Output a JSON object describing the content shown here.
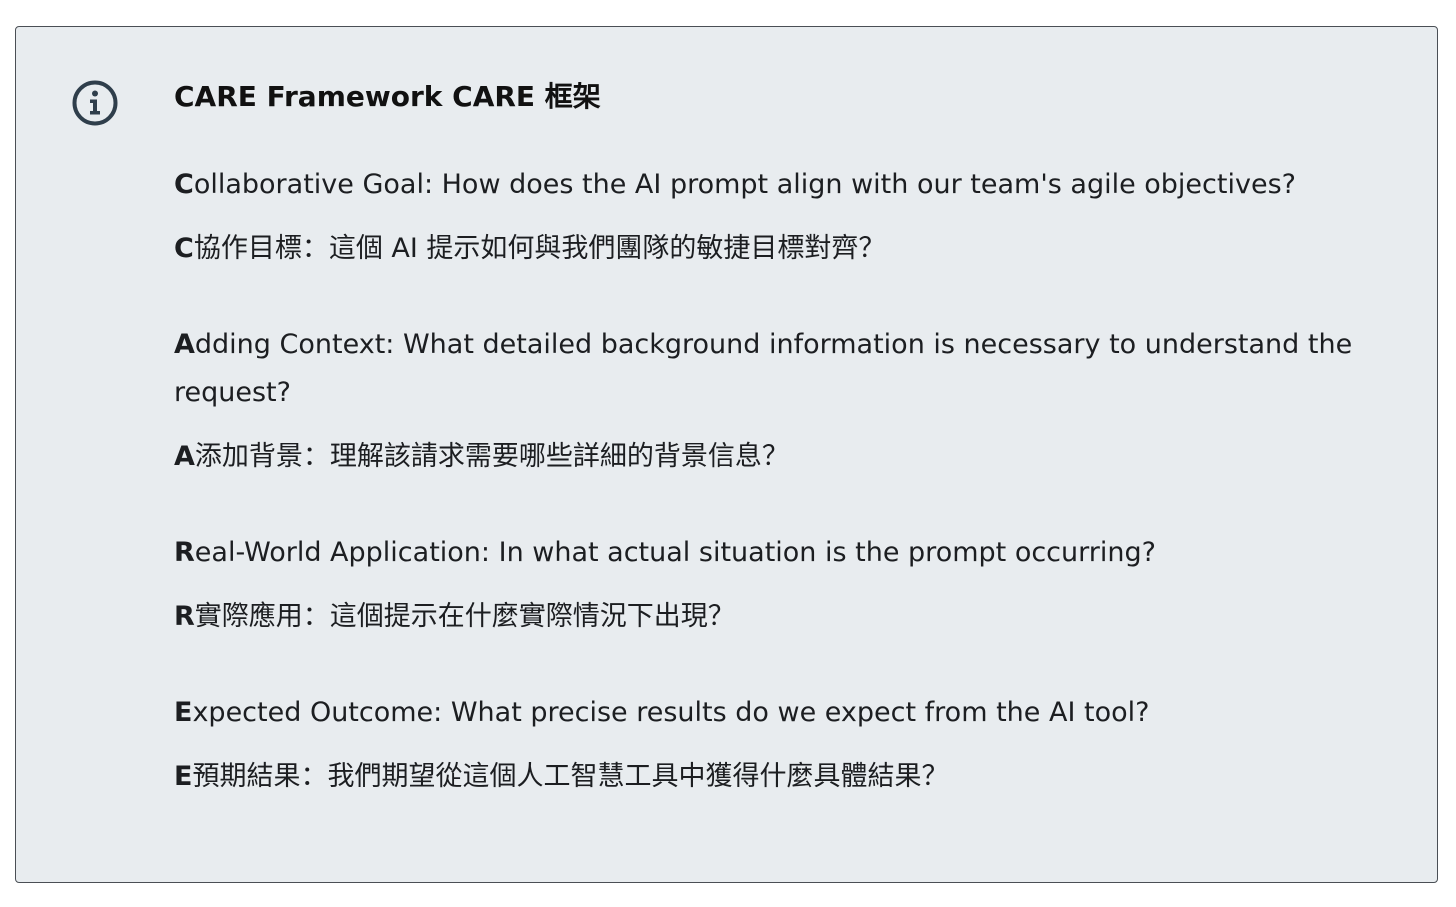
{
  "title": "CARE Framework CARE 框架",
  "icon": "info-icon",
  "colors": {
    "background": "#e8ecef",
    "border": "#4a4f55",
    "icon": "#2f3e4b"
  },
  "sections": [
    {
      "letter": "C",
      "en": "ollaborative Goal: How does the AI prompt align with our team's agile objectives?",
      "zh_letter": "C",
      "zh": "協作目標：這個 AI 提示如何與我們團隊的敏捷目標對齊？"
    },
    {
      "letter": "A",
      "en": "dding Context: What detailed background information is necessary to understand the request?",
      "zh_letter": "A",
      "zh": "添加背景：理解該請求需要哪些詳細的背景信息？"
    },
    {
      "letter": "R",
      "en": "eal-World Application: In what actual situation is the prompt occurring?",
      "zh_letter": "R",
      "zh": "實際應用：這個提示在什麼實際情況下出現？"
    },
    {
      "letter": "E",
      "en": "xpected Outcome: What precise results do we expect from the AI tool?",
      "zh_letter": "E",
      "zh": "預期結果：我們期望從這個人工智慧工具中獲得什麼具體結果？"
    }
  ]
}
